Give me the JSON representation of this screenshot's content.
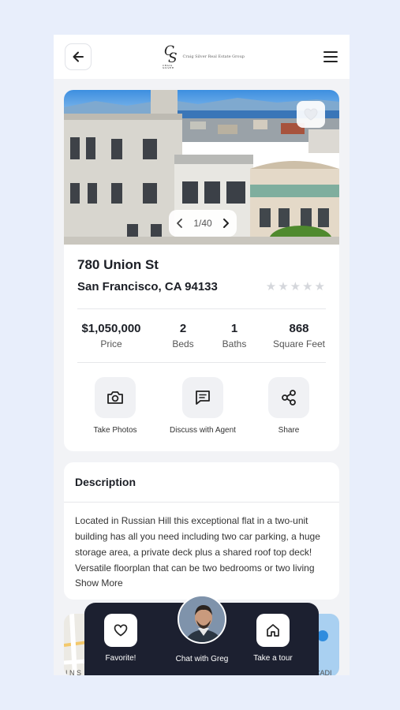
{
  "header": {
    "logo_mark_top": "C",
    "logo_mark_bottom": "S",
    "logo_subtext": "CRAIG SILVER",
    "logo_text": "Craig Silver Real Estate Group"
  },
  "listing": {
    "photo_counter": "1/40",
    "street": "780 Union St",
    "city_line": "San Francisco, CA 94133",
    "rating": 0,
    "rating_max": 5,
    "stats": [
      {
        "value": "$1,050,000",
        "label": "Price"
      },
      {
        "value": "2",
        "label": "Beds"
      },
      {
        "value": "1",
        "label": "Baths"
      },
      {
        "value": "868",
        "label": "Square Feet"
      }
    ],
    "actions": [
      {
        "label": "Take Photos",
        "icon": "camera-icon"
      },
      {
        "label": "Discuss with Agent",
        "icon": "chat-icon"
      },
      {
        "label": "Share",
        "icon": "share-icon"
      }
    ]
  },
  "description": {
    "title": "Description",
    "body": "Located in Russian Hill this exceptional flat in a two-unit building has all you need including two car parking, a huge storage area, a private deck plus a shared roof top deck! Versatile floorplan that can be two bedrooms or two living",
    "show_more": "Show More"
  },
  "bottom_bar": {
    "favorite_label": "Favorite!",
    "chat_label": "Chat with Greg",
    "tour_label": "Take a tour"
  },
  "colors": {
    "background": "#e8eefb",
    "bottom_bar": "#1c2030",
    "star_empty": "#d5d7dc"
  }
}
